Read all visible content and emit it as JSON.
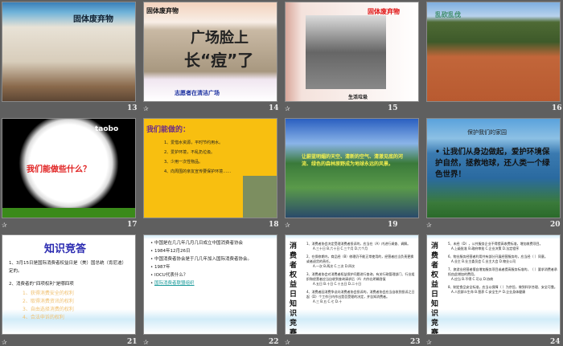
{
  "slides": [
    {
      "number": "13",
      "title": "固体废弃物"
    },
    {
      "number": "14",
      "title": "固体废弃物",
      "headline1": "广场脸上",
      "headline2": "长“痘”了",
      "caption": "志愿者在清洁广场"
    },
    {
      "number": "15",
      "title": "固体废弃物",
      "caption": "生活垃圾"
    },
    {
      "number": "16",
      "title": "乱砍乱伐"
    },
    {
      "number": "17",
      "title": "我们能做些什么？",
      "logo": "taobo"
    },
    {
      "number": "18",
      "title": "我们能做的：",
      "items": [
        "1、爱惜水资源，平时节约用水。",
        "2、爱护环境，不乱扔垃圾。",
        "3、少用一次性物品。",
        "4、向周围的亲友宣传要保护环境……"
      ]
    },
    {
      "number": "19",
      "text": "让蔚蓝明媚的天空、清新的空气、清澈见底的河流、绿色的森林原野成为地球永远的风景。"
    },
    {
      "number": "20",
      "title": "保护我们的家园",
      "text": "让我们从身边做起，爱护环境保护自然，拯救地球，还人类一个绿色世界！"
    },
    {
      "number": "21",
      "title": "知识竞答",
      "q1": "1、3月15日是国际消费者权益日是（美）国总统（肯尼迪）定的。",
      "q2": "2、消费者的”四项权利”是哪四项",
      "answers": [
        "1、获得消费安全的权利",
        "2、取得消费资讯的权利",
        "3、自由选择消费的权利",
        "4、合法申诉的权利"
      ]
    },
    {
      "number": "22",
      "items": [
        "中国是在几几年几月几日成立中国消费者协会",
        "1984年12月26日",
        "中国消费者协会是于几几年加入国际消费者协会。",
        "1987年",
        "IOCU代表什么？",
        "国际消费者联盟组织"
      ]
    },
    {
      "number": "23",
      "side": "消费者权益日知识竞赛",
      "items": [
        "1、消费者协会决定受理消费者投诉的，应当在（A）内进行调查、调解。",
        "A.三十日 B.六十日 C.三个月 D.六个月",
        "2、在保修期内，商品经（B）修理仍不能正常使用的，经营者应当负责更换或者退货的责任。",
        "A.一次 B.两次 C.三次 D.四次",
        "3、消费者协会对消费者权益保护问题进行查询，有关行政管理部门、行业组织和经营者应当自收到查询请求后（A）内作出明确答复",
        "A.五日 B.十日 C.十五日 D.二十日",
        "4、消费者因消费争议向消费者协会投诉的，消费者协会应当自收到投诉之日起（D）个工作日内作出是否受理的决定，并告知消费者。",
        "A.三 B.五 C.七 D.十"
      ]
    },
    {
      "number": "24",
      "side": "消费者权益日知识竞赛",
      "items": [
        "5、未经（D），公共服务企业不得提高收费标准，增加收费项目。",
        "A.上级批准 B.政府审批 C.企业决策 D.法定程序",
        "6、物业服务经营者利用共有部分开展经营服务的，应当经（ ）同意。",
        "A.业主 B.业主委员会 C.业主大会 D.物业公司",
        "7、旅游业经营者擅自增加服务项目或者提高服务标准的，（ ）要求消费者承担由此增加的费用。",
        "A.应当 B.不得 C.可以 D.协商",
        "8、制定食品安全标准，应当以保障（ ）为宗旨，做到科学合理、安全可靠。",
        "A.人民群众生命 B.营养 C.安全生产 D.企业身体健康"
      ]
    }
  ],
  "transition_icon": "animation-star-icon",
  "colors": {
    "background": "#5f5f5f"
  }
}
